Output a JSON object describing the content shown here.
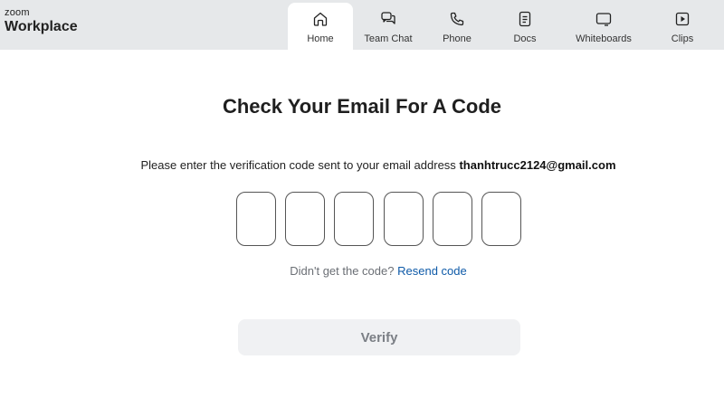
{
  "brand": {
    "small": "zoom",
    "big": "Workplace"
  },
  "tabs": [
    {
      "label": "Home",
      "icon": "home-icon",
      "active": true
    },
    {
      "label": "Team Chat",
      "icon": "chat-icon",
      "active": false
    },
    {
      "label": "Phone",
      "icon": "phone-icon",
      "active": false
    },
    {
      "label": "Docs",
      "icon": "docs-icon",
      "active": false
    },
    {
      "label": "Whiteboards",
      "icon": "whiteboard-icon",
      "active": false
    },
    {
      "label": "Clips",
      "icon": "clips-icon",
      "active": false
    }
  ],
  "main": {
    "title": "Check Your Email For A Code",
    "instruction": "Please enter the verification code sent to your email address",
    "email": "thanhtrucc2124@gmail.com",
    "code_digits": [
      "",
      "",
      "",
      "",
      "",
      ""
    ],
    "resend_prompt": "Didn't get the code?",
    "resend_link": "Resend code",
    "verify_label": "Verify"
  },
  "colors": {
    "topbar": "#e6e8ea",
    "link": "#0e5aa8",
    "button_bg": "#f0f1f3",
    "button_text": "#7b7f85"
  }
}
